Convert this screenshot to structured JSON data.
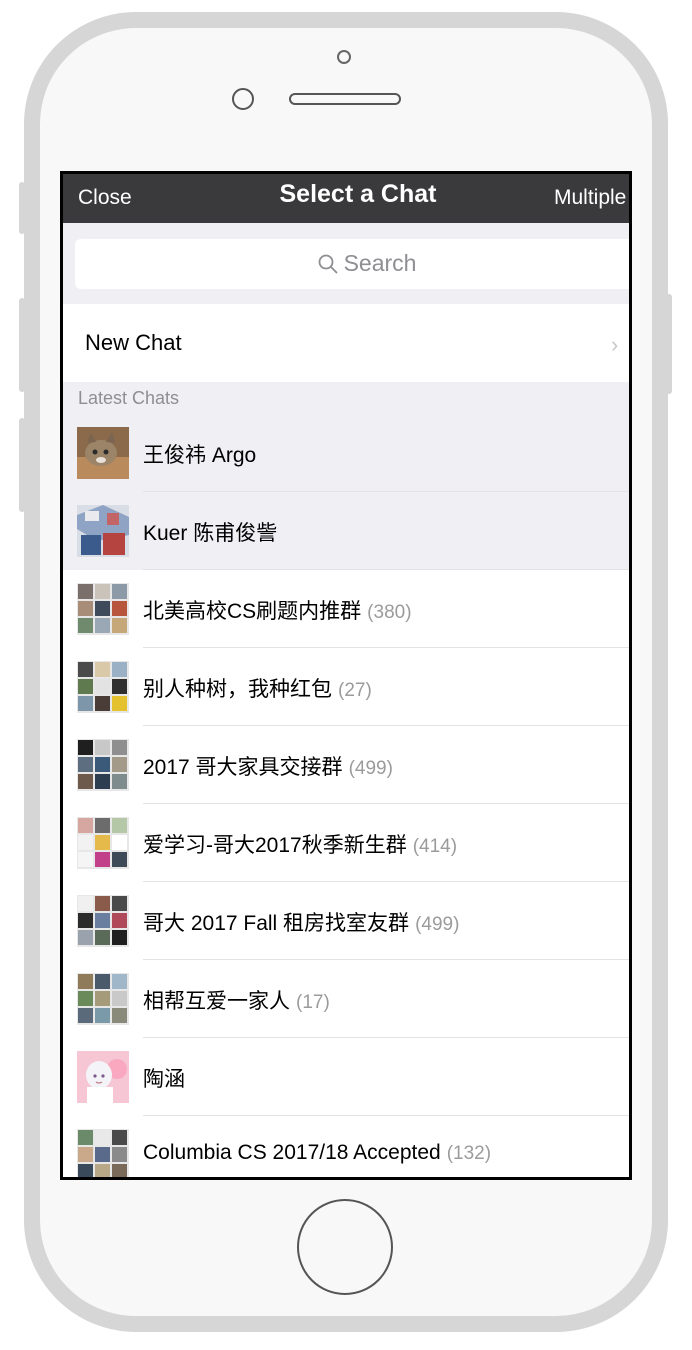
{
  "nav": {
    "close": "Close",
    "title": "Select a Chat",
    "multiple": "Multiple"
  },
  "search": {
    "placeholder": "Search"
  },
  "new_chat": {
    "label": "New Chat"
  },
  "section": {
    "latest": "Latest Chats"
  },
  "chats": [
    {
      "name": "王俊祎 Argo",
      "count": "",
      "icon": "cat-photo-icon"
    },
    {
      "name": "Kuer 陈甫俊訾",
      "count": "",
      "icon": "collage-photo-icon"
    },
    {
      "name": "北美高校CS刷题内推群",
      "count": "(380)",
      "icon": "group-avatar-icon"
    },
    {
      "name": "别人种树，我种红包",
      "count": "(27)",
      "icon": "group-avatar-icon"
    },
    {
      "name": "2017 哥大家具交接群",
      "count": "(499)",
      "icon": "group-avatar-icon"
    },
    {
      "name": "爱学习-哥大2017秋季新生群",
      "count": "(414)",
      "icon": "group-avatar-icon"
    },
    {
      "name": "哥大 2017 Fall 租房找室友群",
      "count": "(499)",
      "icon": "group-avatar-icon"
    },
    {
      "name": "相帮互爱一家人",
      "count": "(17)",
      "icon": "group-avatar-icon"
    },
    {
      "name": "陶涵",
      "count": "",
      "icon": "anime-avatar-icon"
    },
    {
      "name": "Columbia CS 2017/18 Accepted",
      "count": "(132)",
      "icon": "group-avatar-icon"
    }
  ],
  "colors": {
    "nav_bg": "#3a3a3c",
    "section_bg": "#efeff4",
    "count_text": "#9b9b9b"
  }
}
